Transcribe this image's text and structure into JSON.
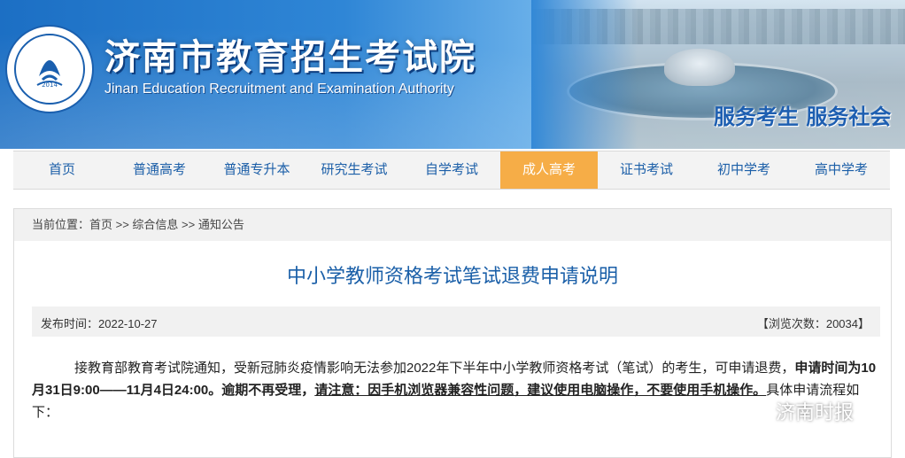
{
  "header": {
    "logo_year": "2014",
    "title": "济南市教育招生考试院",
    "subtitle": "Jinan Education Recruitment and Examination Authority",
    "slogan": "服务考生 服务社会"
  },
  "nav": {
    "items": [
      {
        "label": "首页"
      },
      {
        "label": "普通高考"
      },
      {
        "label": "普通专升本"
      },
      {
        "label": "研究生考试"
      },
      {
        "label": "自学考试"
      },
      {
        "label": "成人高考",
        "active": true
      },
      {
        "label": "证书考试"
      },
      {
        "label": "初中学考"
      },
      {
        "label": "高中学考"
      }
    ],
    "active_color": "#f6ad47"
  },
  "breadcrumb": {
    "text": "当前位置：首页 >> 综合信息 >> 通知公告"
  },
  "article": {
    "title": "中小学教师资格考试笔试退费申请说明",
    "publish_time": "发布时间：2022-10-27",
    "view_count": "【浏览次数：20034】",
    "para_normal_1": "接教育部教育考试院通知，受新冠肺炎疫情影响无法参加2022年下半年中小学教师资格考试（笔试）的考生，可申请退费，",
    "para_bold_1": "申请时间为10月31日9:00——11月4日24:00。逾期不再受理，",
    "para_underline_1": "请注意：因手机浏览器兼容性问题，建议使用电脑操作，不要使用手机操作。",
    "para_normal_2": "具体申请流程如下："
  },
  "watermark": {
    "text": "济南时报",
    "icon": "wechat-icon"
  },
  "colors": {
    "link_blue": "#1c5fa8",
    "title_blue": "#1a5fa8"
  }
}
